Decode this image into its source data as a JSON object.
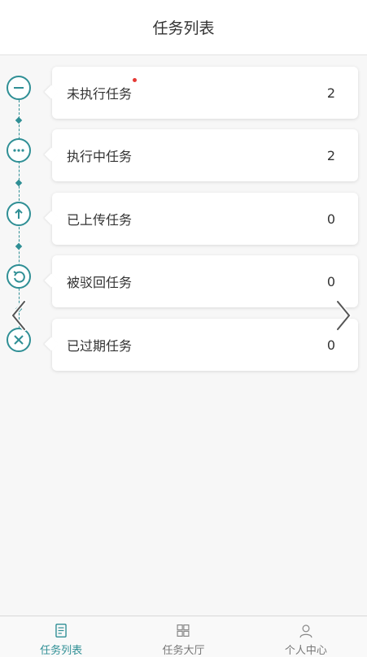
{
  "header": {
    "title": "任务列表"
  },
  "tasks": [
    {
      "label": "未执行任务",
      "count": "2",
      "icon": "minus-icon",
      "new_badge": true
    },
    {
      "label": "执行中任务",
      "count": "2",
      "icon": "ellipsis-icon",
      "new_badge": false
    },
    {
      "label": "已上传任务",
      "count": "0",
      "icon": "arrow-up-icon",
      "new_badge": false
    },
    {
      "label": "被驳回任务",
      "count": "0",
      "icon": "undo-icon",
      "new_badge": false
    },
    {
      "label": "已过期任务",
      "count": "0",
      "icon": "close-icon",
      "new_badge": false
    }
  ],
  "tabbar": {
    "items": [
      {
        "label": "任务列表",
        "icon": "document-list-icon",
        "active": true
      },
      {
        "label": "任务大厅",
        "icon": "grid-icon",
        "active": false
      },
      {
        "label": "个人中心",
        "icon": "person-icon",
        "active": false
      }
    ]
  },
  "colors": {
    "accent": "#2f8f95",
    "badge": "#e53935",
    "background": "#f7f7f7"
  },
  "nav": {
    "prev_icon": "chevron-left-icon",
    "next_icon": "chevron-right-icon"
  }
}
